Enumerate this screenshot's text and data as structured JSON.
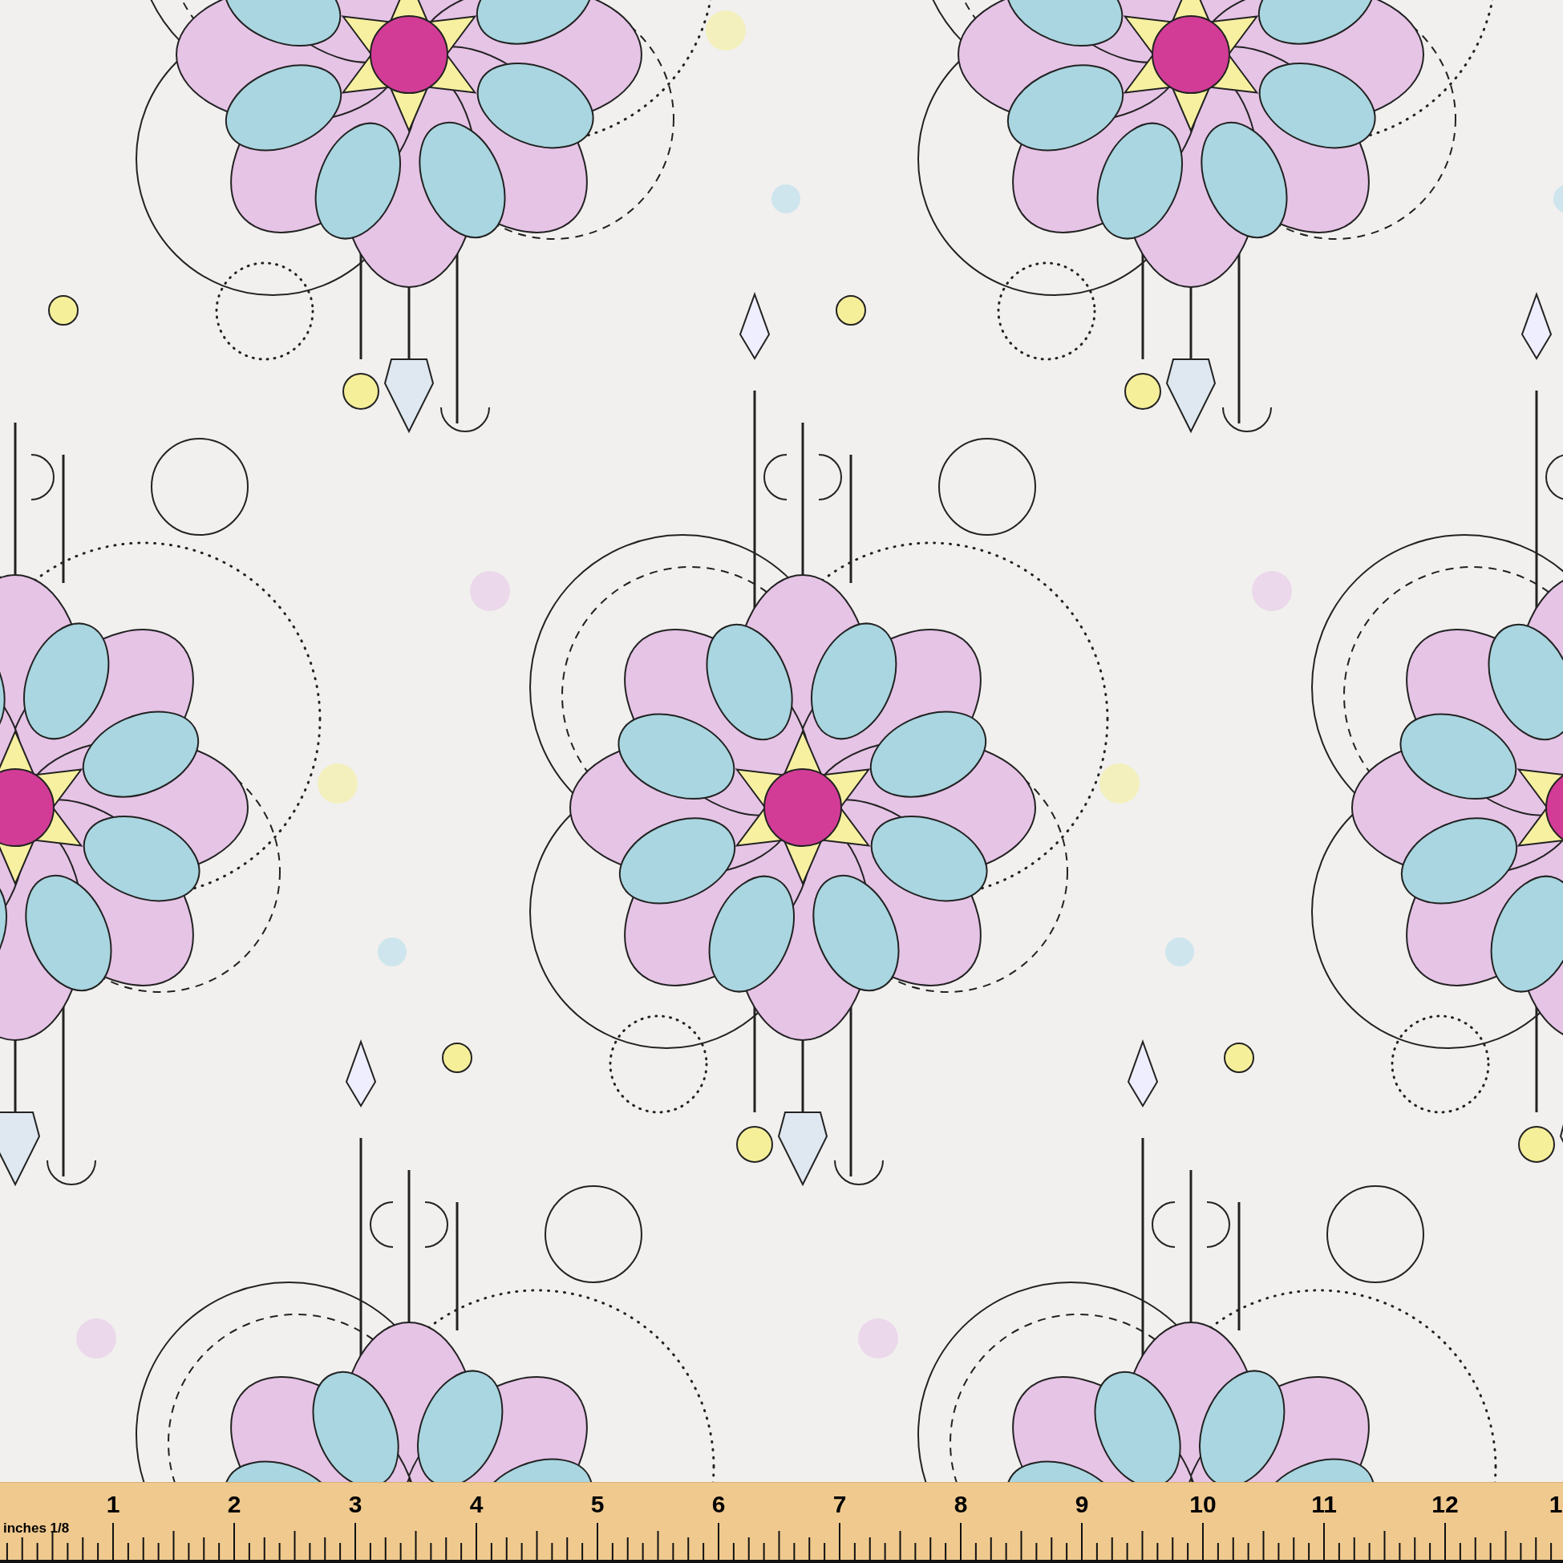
{
  "ruler": {
    "unit_label": "inches 1/8",
    "numbers": [
      "1",
      "2",
      "3",
      "4",
      "5",
      "6",
      "7",
      "8",
      "9",
      "10",
      "11",
      "12",
      "1"
    ]
  }
}
